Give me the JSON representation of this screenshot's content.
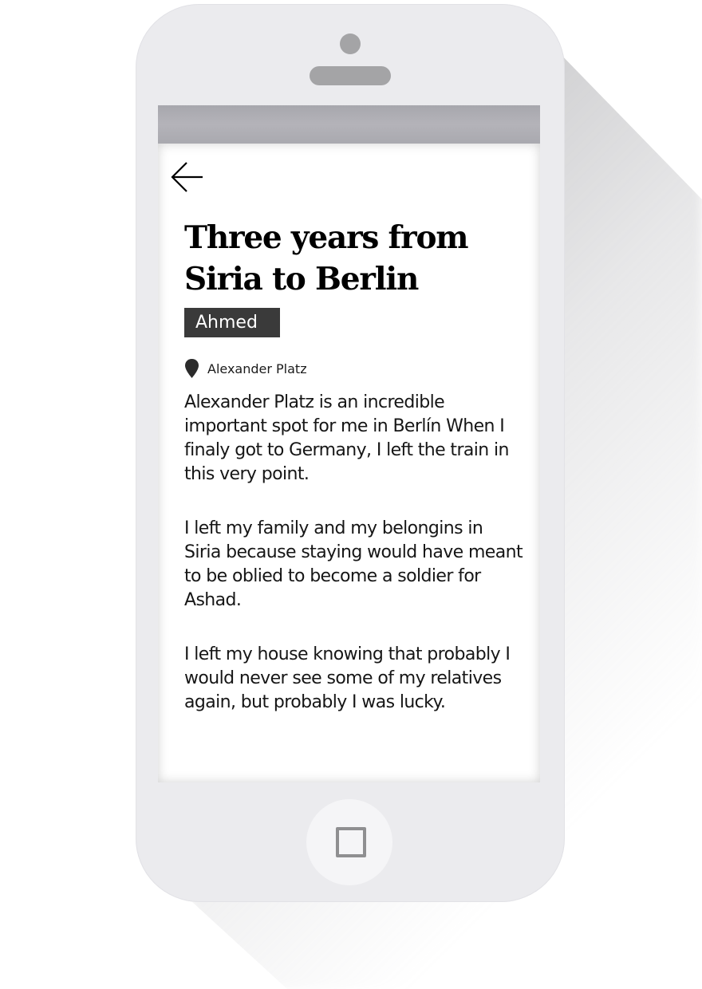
{
  "article": {
    "title_line_1": "Three years from",
    "title_line_2": "Siria to Berlin",
    "author": "Ahmed",
    "location": "Alexander Platz",
    "paragraphs": [
      "Alexander Platz is an incredible important spot for me in Berlín When I finaly got to Germany, I left the train in this very point.",
      "I left my family and my belongins in Siria because staying would have meant to be oblied to become a soldier for Ashad.",
      "I left my house knowing that probably I would never see some of my relatives again, but probably I was lucky."
    ]
  },
  "icons": {
    "back": "arrow-left-icon",
    "location": "map-pin-icon",
    "home": "home-square-icon"
  },
  "colors": {
    "phone_body": "#ebebee",
    "author_badge": "#3a3a3a",
    "status_strip": "#a9a9af",
    "text": "#161616"
  }
}
